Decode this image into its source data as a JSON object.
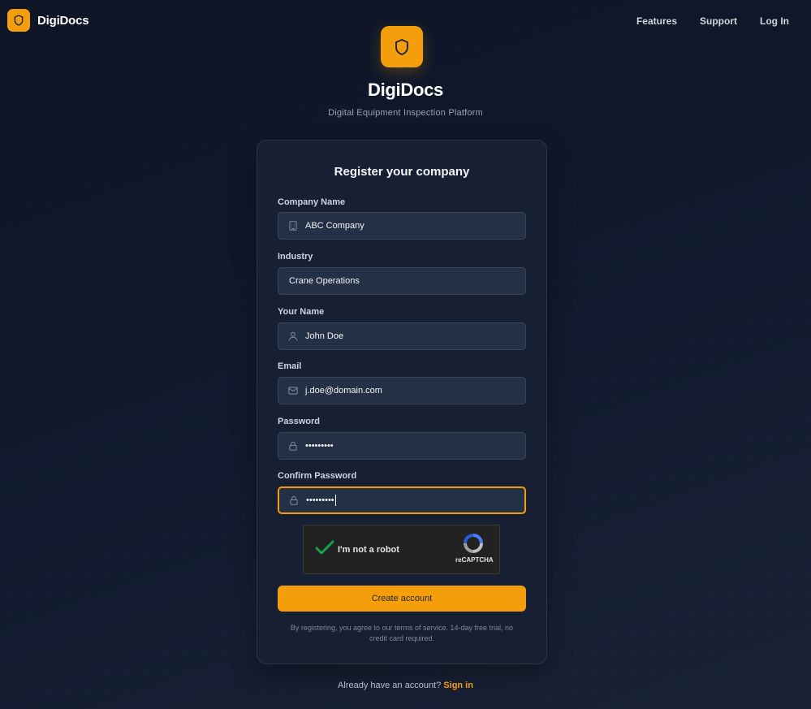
{
  "header": {
    "brand": "DigiDocs",
    "nav": [
      "Features",
      "Support",
      "Log In"
    ]
  },
  "hero": {
    "title": "DigiDocs",
    "subtitle": "Digital Equipment Inspection Platform"
  },
  "form": {
    "title": "Register your company",
    "fields": [
      {
        "label": "Company Name",
        "value": "ABC Company",
        "icon": "building-icon"
      },
      {
        "label": "Industry",
        "value": "Crane Operations",
        "icon": ""
      },
      {
        "label": "Your Name",
        "value": "John Doe",
        "icon": "user-icon"
      },
      {
        "label": "Email",
        "value": "j.doe@domain.com",
        "icon": "mail-icon"
      },
      {
        "label": "Password",
        "value": "•••••••••",
        "icon": "lock-icon"
      },
      {
        "label": "Confirm Password",
        "value": "•••••••••",
        "icon": "lock-icon"
      }
    ],
    "captcha": {
      "label": "I'm not a robot",
      "brand": "reCAPTCHA"
    },
    "submit_label": "Create account",
    "terms": "By registering, you agree to our terms of service. 14-day free trial, no credit card required."
  },
  "footer": {
    "prompt": "Already have an account?",
    "link": "Sign in"
  },
  "colors": {
    "accent": "#f59e0b",
    "background": "#0f1728",
    "card": "#172033",
    "input": "#243046"
  }
}
